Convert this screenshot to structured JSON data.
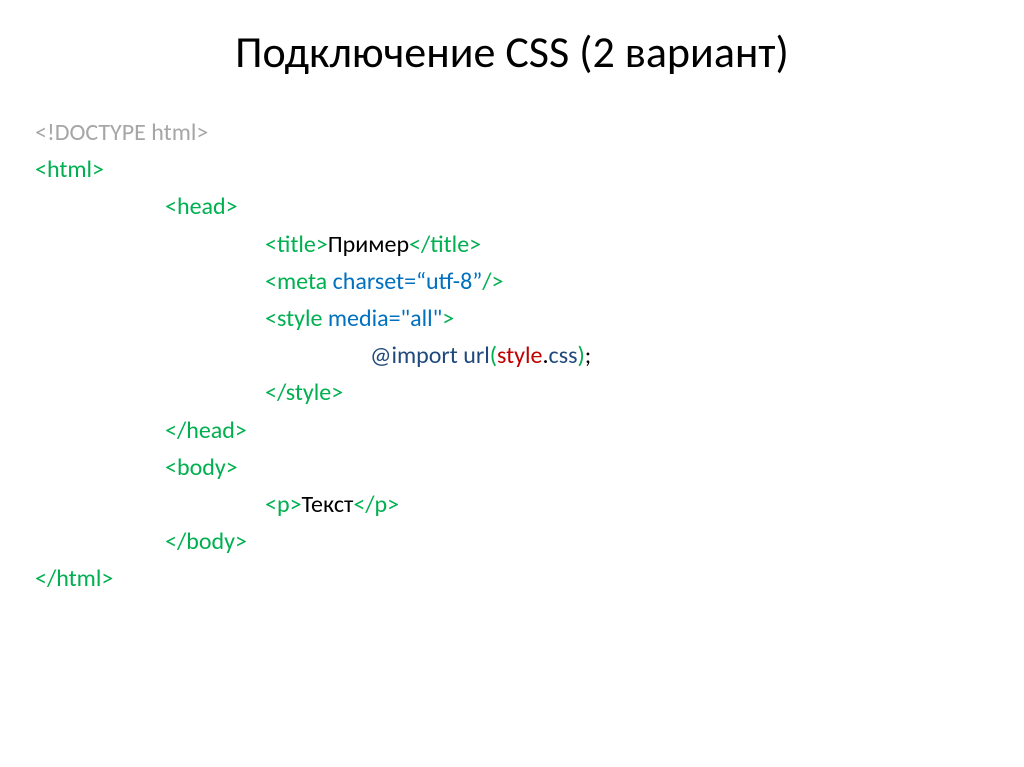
{
  "title": "Подключение CSS (2 вариант)",
  "code": {
    "doctype": "<!DOCTYPE html>",
    "html_open": "<html>",
    "head_open": "<head>",
    "title_open": "<title>",
    "title_text": "Пример",
    "title_close": "</title>",
    "meta_open": "<meta",
    "meta_attr": " charset=“utf-8”",
    "meta_close": "/>",
    "style_open": "<style",
    "style_attr": " media=\"all\"",
    "style_open_end": ">",
    "import_kw": "@import",
    "import_url": "url",
    "import_paren_open": "(",
    "import_file": "style",
    "import_dot": ".",
    "import_ext": "css",
    "import_paren_close": ")",
    "import_semi": ";",
    "style_close": "</style>",
    "head_close": "</head>",
    "body_open": "<body>",
    "p_open": "<p>",
    "p_text": "Текст",
    "p_close": "</p>",
    "body_close": "</body>",
    "html_close": "</html>"
  }
}
